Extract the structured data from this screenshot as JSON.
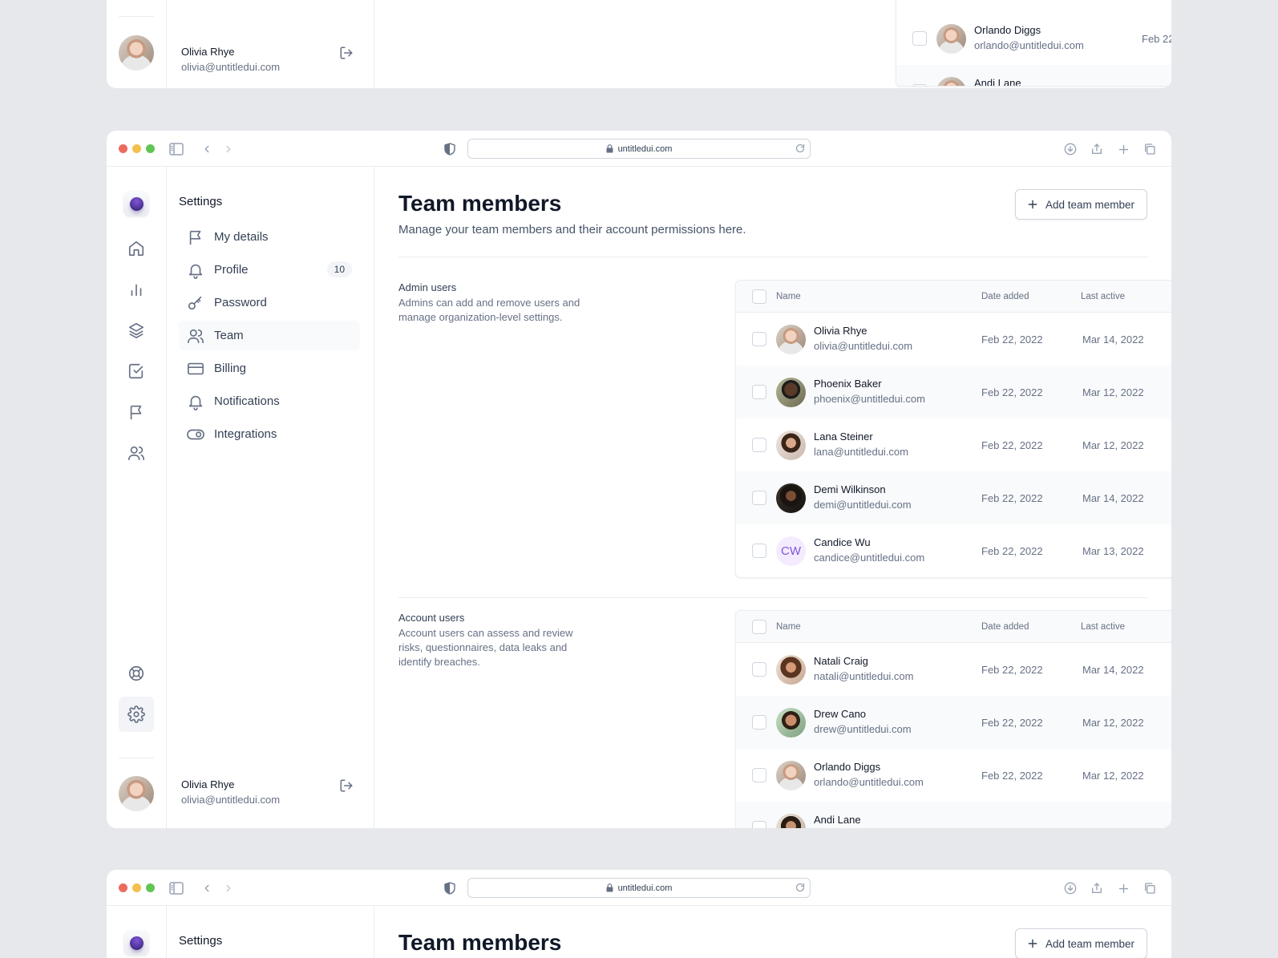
{
  "browser": {
    "url": "untitledui.com"
  },
  "settings": {
    "title": "Settings",
    "items": [
      {
        "label": "My details",
        "icon": "flag-icon"
      },
      {
        "label": "Profile",
        "icon": "bell-icon",
        "badge": "10"
      },
      {
        "label": "Password",
        "icon": "key-icon"
      },
      {
        "label": "Team",
        "icon": "users-icon",
        "active": true
      },
      {
        "label": "Billing",
        "icon": "credit-card-icon"
      },
      {
        "label": "Notifications",
        "icon": "bell-icon"
      },
      {
        "label": "Integrations",
        "icon": "toggle-icon"
      }
    ]
  },
  "user": {
    "name": "Olivia Rhye",
    "email": "olivia@untitledui.com"
  },
  "page": {
    "title": "Team members",
    "subtitle": "Manage your team members and their account permissions here.",
    "add_button": "Add team member"
  },
  "columns": {
    "name": "Name",
    "date_added": "Date added",
    "last_active": "Last active"
  },
  "admin": {
    "title": "Admin users",
    "description": "Admins can add and remove users and manage organization-level settings.",
    "rows": [
      {
        "name": "Olivia Rhye",
        "email": "olivia@untitledui.com",
        "date_added": "Feb 22, 2022",
        "last_active": "Mar 14, 2022"
      },
      {
        "name": "Phoenix Baker",
        "email": "phoenix@untitledui.com",
        "date_added": "Feb 22, 2022",
        "last_active": "Mar 12, 2022"
      },
      {
        "name": "Lana Steiner",
        "email": "lana@untitledui.com",
        "date_added": "Feb 22, 2022",
        "last_active": "Mar 12, 2022"
      },
      {
        "name": "Demi Wilkinson",
        "email": "demi@untitledui.com",
        "date_added": "Feb 22, 2022",
        "last_active": "Mar 14, 2022"
      },
      {
        "name": "Candice Wu",
        "email": "candice@untitledui.com",
        "date_added": "Feb 22, 2022",
        "last_active": "Mar 13, 2022",
        "initials": "CW"
      }
    ]
  },
  "account": {
    "title": "Account users",
    "description": "Account users can assess and review risks, questionnaires, data leaks and identify breaches.",
    "rows": [
      {
        "name": "Natali Craig",
        "email": "natali@untitledui.com",
        "date_added": "Feb 22, 2022",
        "last_active": "Mar 14, 2022"
      },
      {
        "name": "Drew Cano",
        "email": "drew@untitledui.com",
        "date_added": "Feb 22, 2022",
        "last_active": "Mar 12, 2022"
      },
      {
        "name": "Orlando Diggs",
        "email": "orlando@untitledui.com",
        "date_added": "Feb 22, 2022",
        "last_active": "Mar 12, 2022"
      },
      {
        "name": "Andi Lane",
        "email": "",
        "date_added": "",
        "last_active": ""
      }
    ]
  },
  "colors": {
    "accent": "#7f56d9",
    "border": "#eaecf0",
    "text": "#101828",
    "muted": "#667085"
  }
}
